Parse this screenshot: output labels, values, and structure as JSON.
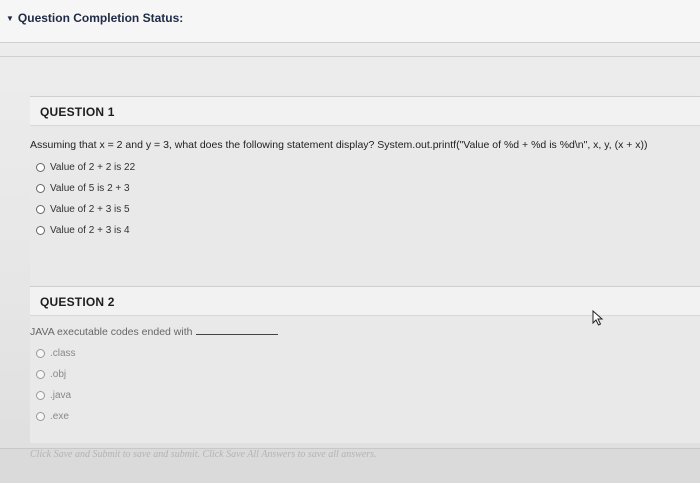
{
  "status": {
    "title": "Question Completion Status:"
  },
  "questions": [
    {
      "header": "QUESTION 1",
      "text": "Assuming that x = 2 and y = 3, what does the following statement display? System.out.printf(\"Value of %d + %d is %d\\n\", x, y, (x + x))",
      "options": [
        "Value of 2 + 2 is 22",
        "Value of 5 is 2 + 3",
        "Value of 2 + 3 is 5",
        "Value of 2 + 3 is 4"
      ]
    },
    {
      "header": "QUESTION 2",
      "text": "JAVA executable codes ended with",
      "options": [
        ".class",
        ".obj",
        ".java",
        ".exe"
      ]
    }
  ],
  "footer": {
    "text": "Click Save and Submit to save and submit. Click Save All Answers to save all answers."
  }
}
